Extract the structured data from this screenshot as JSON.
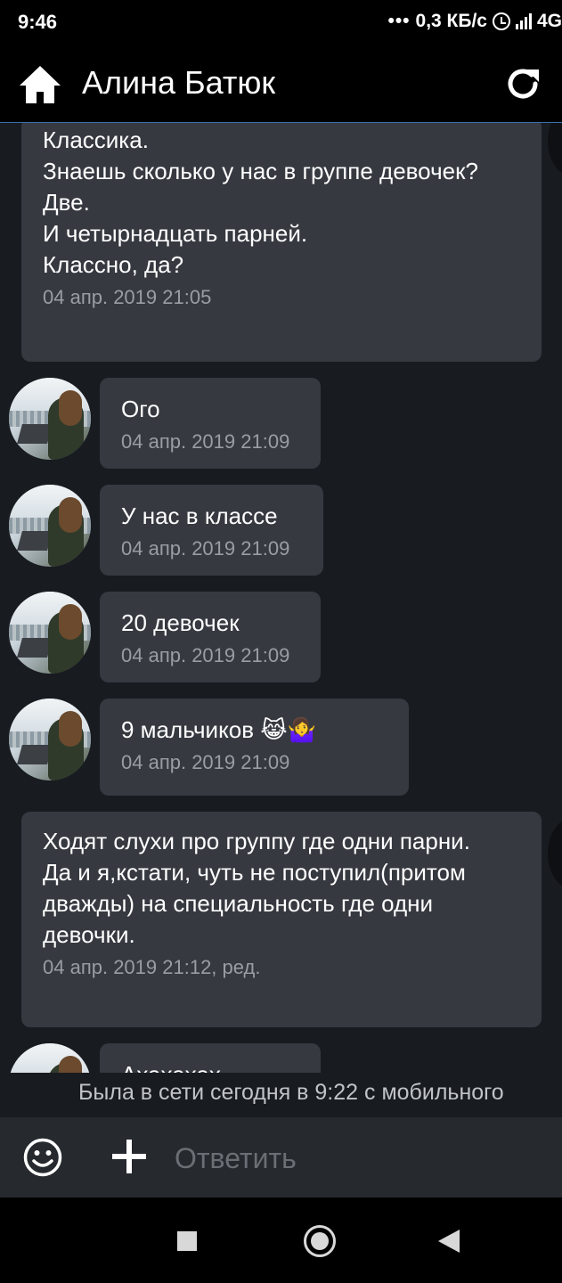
{
  "status_bar": {
    "time": "9:46",
    "network_speed": "0,3 КБ/с",
    "network_type": "4G",
    "icons": [
      "alarm-icon",
      "signal-icon"
    ]
  },
  "app_bar": {
    "title": "Алина Батюк",
    "icons": [
      "home-icon",
      "refresh-icon"
    ]
  },
  "messages": [
    {
      "direction": "out",
      "text": "Классика.\nЗнаешь сколько у нас в группе девочек?\nДве.\nИ четырнадцать парней.\nКлассно, да?",
      "meta": "04 апр. 2019 21:05"
    },
    {
      "direction": "in",
      "text": "Ого",
      "meta": "04 апр. 2019 21:09"
    },
    {
      "direction": "in",
      "text": "У нас в классе",
      "meta": "04 апр. 2019 21:09"
    },
    {
      "direction": "in",
      "text": "20 девочек",
      "meta": "04 апр. 2019 21:09"
    },
    {
      "direction": "in",
      "text": "9 мальчиков 😹🤷‍♀️",
      "meta": "04 апр. 2019 21:09"
    },
    {
      "direction": "out",
      "text": "Ходят слухи про группу где одни парни.\nДа и я,кстати, чуть не поступил(притом дважды) на специальность где одни девочки.",
      "meta": "04 апр. 2019 21:12, ред."
    },
    {
      "direction": "in",
      "text": "Ахахахах",
      "meta": ""
    }
  ],
  "presence_status": "Была в сети сегодня в 9:22 с мобильного",
  "composer": {
    "placeholder": "Ответить",
    "icons": [
      "emoji-icon",
      "add-icon"
    ]
  },
  "nav_bar": {
    "icons": [
      "recents-icon",
      "home-nav-icon",
      "back-icon"
    ]
  }
}
